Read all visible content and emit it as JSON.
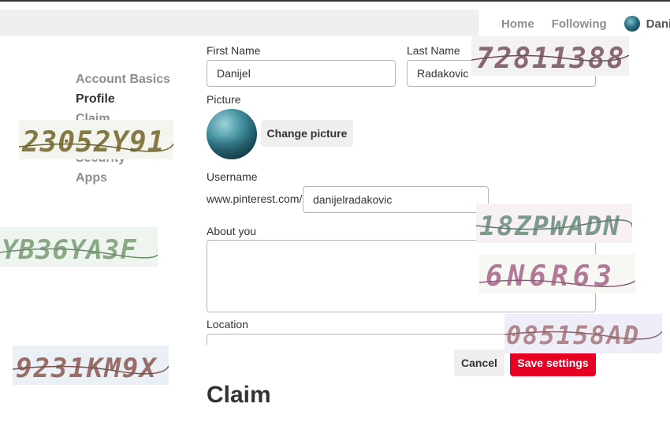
{
  "header": {
    "nav": [
      "Home",
      "Following"
    ],
    "user_name": "Danijel"
  },
  "sidebar": {
    "items": [
      {
        "label": "Account Basics"
      },
      {
        "label": "Profile"
      },
      {
        "label": "Claim"
      },
      {
        "label": "Security"
      },
      {
        "label": "Apps"
      }
    ]
  },
  "form": {
    "first_name_label": "First Name",
    "first_name_value": "Danijel",
    "last_name_label": "Last Name",
    "last_name_value": "Radakovic",
    "picture_label": "Picture",
    "change_picture": "Change picture",
    "username_label": "Username",
    "url_prefix": "www.pinterest.com/",
    "username_value": "danijelradakovic",
    "about_label": "About you",
    "about_value": "",
    "location_label": "Location",
    "location_value": "",
    "cancel": "Cancel",
    "save": "Save settings"
  },
  "claim_section": {
    "title": "Claim"
  },
  "captchas": [
    {
      "text": "72811388"
    },
    {
      "text": "23052Y91"
    },
    {
      "text": "18ZPWADN"
    },
    {
      "text": "YB36YA3F"
    },
    {
      "text": "6N6R63"
    },
    {
      "text": "085158AD"
    },
    {
      "text": "9231KM9X"
    }
  ],
  "colors": {
    "accent": "#e60023",
    "muted_text": "#8e8e8e",
    "text": "#333333"
  }
}
